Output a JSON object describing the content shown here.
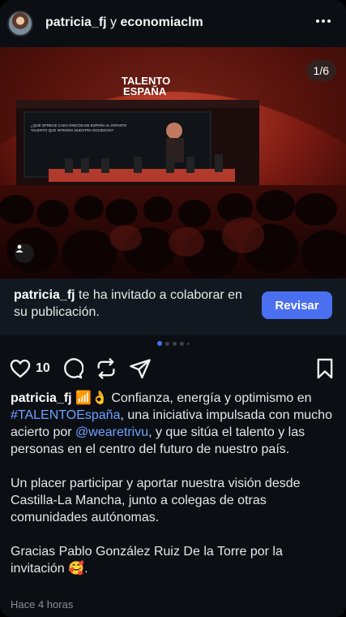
{
  "header": {
    "user1": "patricia_fj",
    "joiner": "y",
    "user2": "economiaclm",
    "more_icon": "more-horizontal-icon"
  },
  "photo": {
    "counter": "1/6",
    "stage_logo_line1": "TALENTO",
    "stage_logo_line2": "ESPAÑA",
    "screen_line1": "¿QUÉ OFRECE CADA RINCÓN DE ESPAÑA AL INFINITO",
    "screen_line2": "TALENTO QUE INTEGRA NUESTRA SOCIEDAD?",
    "tag_icon": "user-tag-icon"
  },
  "invite": {
    "username": "patricia_fj",
    "message": " te ha invitado a colaborar en su publicación.",
    "button_label": "Revisar"
  },
  "carousel": {
    "current": 1,
    "total_visible_dots": 5
  },
  "actions": {
    "likes": "10",
    "icons": [
      "heart-icon",
      "comment-icon",
      "repost-icon",
      "share-icon",
      "bookmark-icon"
    ]
  },
  "caption": {
    "username": "patricia_fj",
    "p1_a": " 📶👌 Confianza, energía y optimismo en ",
    "hashtag": "#TALENTOEspaña",
    "p1_b": ", una iniciativa impulsada con mucho acierto por ",
    "mention": "@wearetrivu",
    "p1_c": ", y que sitúa el talento y las personas en el centro del futuro de nuestro país.",
    "p2": "Un placer participar y aportar nuestra visión desde Castilla-La Mancha, junto a colegas de otras comunidades autónomas.",
    "p3": "Gracias Pablo González Ruiz De la Torre por la invitación 🥰."
  },
  "timestamp": "Hace 4 horas",
  "colors": {
    "accent": "#4a6ff0",
    "link": "#6fa0ff",
    "background": "#0b0f14"
  }
}
